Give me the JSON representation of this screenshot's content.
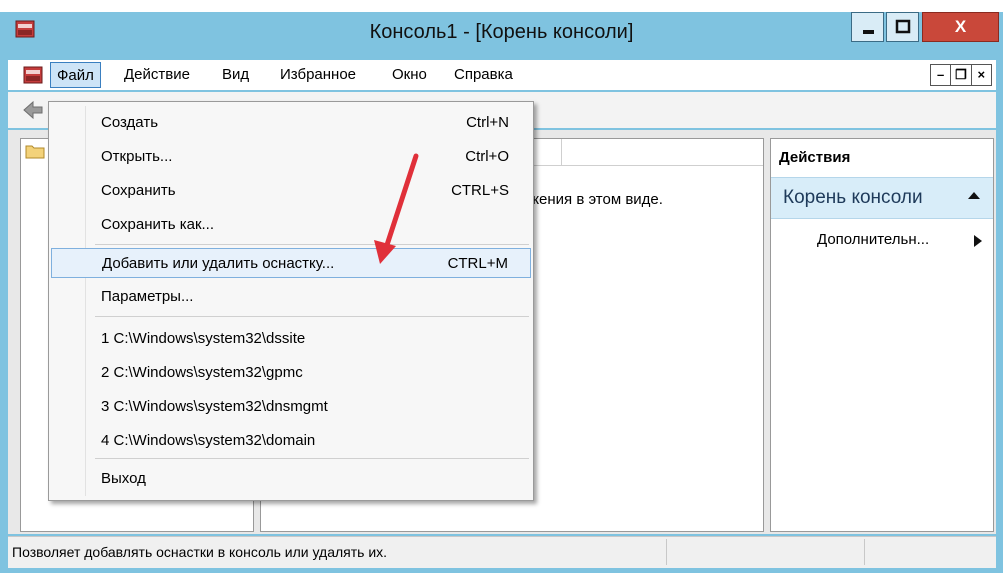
{
  "window": {
    "title": "Консоль1 - [Корень консоли]",
    "close_glyph": "X",
    "accent_color": "#7fc3e0",
    "close_color": "#c9483a"
  },
  "menubar": {
    "items": [
      {
        "label": "Файл"
      },
      {
        "label": "Действие"
      },
      {
        "label": "Вид"
      },
      {
        "label": "Избранное"
      },
      {
        "label": "Окно"
      },
      {
        "label": "Справка"
      }
    ],
    "mdi_buttons": [
      "–",
      "❐",
      "×"
    ]
  },
  "file_menu": {
    "items": [
      {
        "label": "Создать",
        "shortcut": "Ctrl+N"
      },
      {
        "label": "Открыть...",
        "shortcut": "Ctrl+O"
      },
      {
        "label": "Сохранить",
        "shortcut": "CTRL+S"
      },
      {
        "label": "Сохранить как...",
        "shortcut": ""
      },
      {
        "label": "Добавить или удалить оснастку...",
        "shortcut": "CTRL+M"
      },
      {
        "label": "Параметры...",
        "shortcut": ""
      },
      {
        "label": "1 C:\\Windows\\system32\\dssite",
        "shortcut": ""
      },
      {
        "label": "2 C:\\Windows\\system32\\gpmc",
        "shortcut": ""
      },
      {
        "label": "3 C:\\Windows\\system32\\dnsmgmt",
        "shortcut": ""
      },
      {
        "label": "4 C:\\Windows\\system32\\domain",
        "shortcut": ""
      },
      {
        "label": "Выход",
        "shortcut": ""
      }
    ]
  },
  "result_pane": {
    "empty_message": "жения в этом виде."
  },
  "actions_pane": {
    "title": "Действия",
    "group_label": "Корень консоли",
    "item_label": "Дополнительн..."
  },
  "statusbar": {
    "text": "Позволяет добавлять оснастки в консоль или удалять их."
  },
  "annotation": {
    "arrow_color": "#e0303a"
  }
}
